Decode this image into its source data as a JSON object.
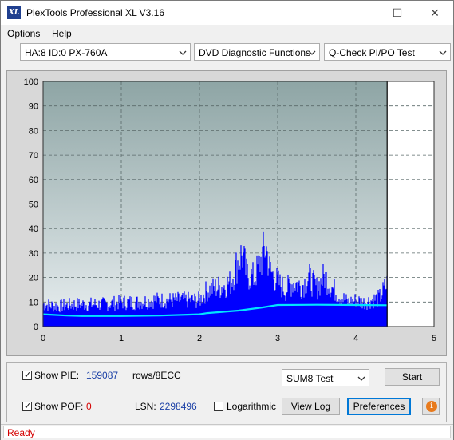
{
  "window": {
    "title": "PlexTools Professional XL V3.16",
    "icon_text": "XL"
  },
  "window_controls": {
    "minimize": "—",
    "maximize": "☐",
    "close": "✕"
  },
  "menu": {
    "items": [
      {
        "label": "Options"
      },
      {
        "label": "Help"
      }
    ]
  },
  "toolbar": {
    "device": "HA:8 ID:0  PX-760A",
    "function": "DVD Diagnostic Functions",
    "test": "Q-Check PI/PO Test"
  },
  "chart_data": {
    "type": "area",
    "title": "",
    "xlabel": "",
    "ylabel": "",
    "xlim": [
      0,
      5
    ],
    "ylim": [
      0,
      100
    ],
    "x_ticks": [
      "0",
      "1",
      "2",
      "3",
      "4",
      "5"
    ],
    "y_ticks": [
      "0",
      "10",
      "20",
      "30",
      "40",
      "50",
      "60",
      "70",
      "80",
      "90",
      "100"
    ],
    "grid": true,
    "scan_end": 4.4,
    "series": [
      {
        "style": "bars",
        "color": "#0000ff",
        "x": [
          0.0,
          0.2,
          0.4,
          0.6,
          0.8,
          1.0,
          1.2,
          1.4,
          1.6,
          1.8,
          2.0,
          2.1,
          2.2,
          2.3,
          2.4,
          2.5,
          2.55,
          2.6,
          2.7,
          2.8,
          2.85,
          2.9,
          3.0,
          3.1,
          3.2,
          3.3,
          3.4,
          3.5,
          3.6,
          3.7,
          3.8,
          3.9,
          4.0,
          4.1,
          4.2,
          4.3,
          4.4
        ],
        "y": [
          11,
          10,
          11,
          11,
          11,
          12,
          12,
          13,
          13,
          13,
          13,
          18,
          19,
          20,
          22,
          33,
          36,
          26,
          24,
          34,
          40,
          28,
          22,
          18,
          22,
          20,
          24,
          19,
          25,
          19,
          15,
          12,
          13,
          12,
          13,
          14,
          21
        ]
      },
      {
        "style": "line",
        "color": "#00e5ff",
        "x": [
          0.0,
          0.3,
          0.5,
          1.0,
          1.5,
          2.0,
          2.1,
          2.5,
          2.8,
          3.0,
          3.5,
          4.0,
          4.4
        ],
        "y": [
          5,
          4.5,
          4.3,
          4.3,
          4.5,
          5.0,
          5.5,
          6.5,
          7.8,
          8.8,
          8.9,
          8.8,
          8.7
        ]
      }
    ]
  },
  "bottom": {
    "show_pie_label": "Show PIE:",
    "pie_value": "159087",
    "rows_unit": "rows/8ECC",
    "show_pof_label": "Show POF:",
    "pof_value": "0",
    "lsn_label": "LSN:",
    "lsn_value": "2298496",
    "logarithmic_label": "Logarithmic",
    "test_select": "SUM8 Test",
    "start_button": "Start",
    "view_log_button": "View Log",
    "preferences_button": "Preferences",
    "info_icon": "i"
  },
  "status": {
    "text": "Ready"
  }
}
